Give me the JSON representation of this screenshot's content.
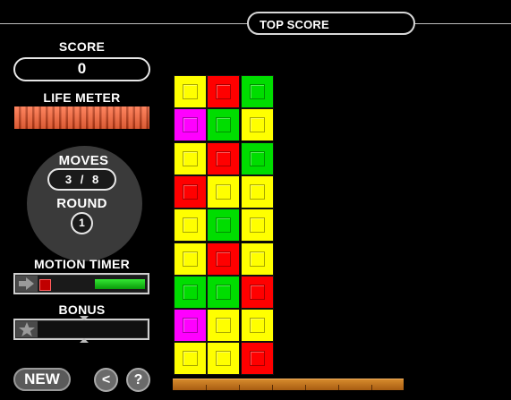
{
  "header": {
    "top_score_label": "TOP SCORE"
  },
  "score": {
    "label": "SCORE",
    "value": "0"
  },
  "life_meter": {
    "label": "LIFE METER",
    "level": 1.0
  },
  "moves": {
    "label": "MOVES",
    "current": "3",
    "separator": "/",
    "total": "8"
  },
  "round": {
    "label": "ROUND",
    "value": "1"
  },
  "motion_timer": {
    "label": "MOTION TIMER",
    "elapsed_fraction": 0.09,
    "remaining_fraction": 0.47
  },
  "bonus": {
    "label": "BONUS"
  },
  "buttons": {
    "new": "NEW",
    "back": "<",
    "help": "?"
  },
  "colors": {
    "yellow": "#ffff00",
    "red": "#ff0000",
    "green": "#00dd00",
    "magenta": "#ff00ff",
    "life": "#ff6a3d",
    "floor": "#c77720"
  },
  "board": {
    "columns": 3,
    "rows": [
      [
        "yellow",
        "red",
        "green"
      ],
      [
        "magenta",
        "green",
        "yellow"
      ],
      [
        "yellow",
        "red",
        "green"
      ],
      [
        "red",
        "yellow",
        "yellow"
      ],
      [
        "yellow",
        "green",
        "yellow"
      ],
      [
        "yellow",
        "red",
        "yellow"
      ],
      [
        "green",
        "green",
        "red"
      ],
      [
        "magenta",
        "yellow",
        "yellow"
      ],
      [
        "yellow",
        "yellow",
        "red"
      ]
    ]
  }
}
